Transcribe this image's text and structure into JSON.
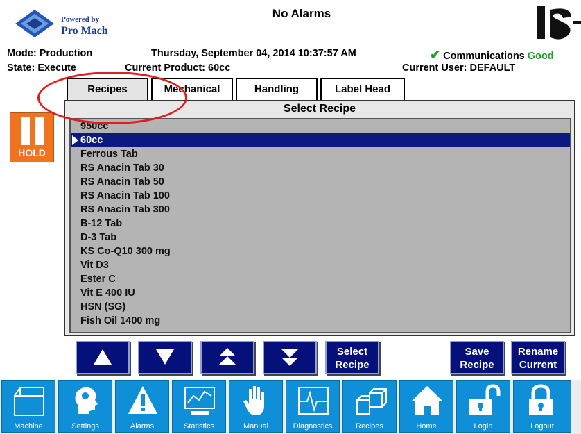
{
  "header": {
    "powered_by": "Powered by",
    "brand": "Pro Mach",
    "alarm_status": "No Alarms",
    "mode": "Mode: Production",
    "state": "State: Execute",
    "datetime": "Thursday, September 04, 2014 10:37:57 AM",
    "current_product": "Current Product: 60cc",
    "communications_label": "Communications",
    "communications_status": "Good",
    "current_user": "Current User:   DEFAULT"
  },
  "tabs": [
    {
      "label": "Recipes",
      "active": true
    },
    {
      "label": "Mechanical",
      "active": false
    },
    {
      "label": "Handling",
      "active": false
    },
    {
      "label": "Label Head",
      "active": false
    }
  ],
  "panel": {
    "title": "Select Recipe",
    "selected_recipe": "60cc",
    "recipes": [
      "950cc",
      "60cc",
      "Ferrous Tab",
      "RS Anacin Tab 30",
      "RS Anacin Tab 50",
      "RS Anacin Tab 100",
      "RS Anacin Tab 300",
      "B-12 Tab",
      "D-3 Tab",
      "KS Co-Q10 300 mg",
      "Vit D3",
      "Ester C",
      "Vit E 400 IU",
      "HSN (SG)",
      "Fish Oil 1400 mg"
    ]
  },
  "hold_button": {
    "label": "HOLD"
  },
  "nav_buttons": {
    "up": "up-arrow-icon",
    "down": "down-arrow-icon",
    "page_up": "double-up-arrow-icon",
    "page_down": "double-down-arrow-icon",
    "select_recipe": [
      "Select",
      "Recipe"
    ],
    "save_recipe": [
      "Save",
      "Recipe"
    ],
    "rename_current": [
      "Rename",
      "Current"
    ]
  },
  "bottom_nav": [
    {
      "label": "Machine",
      "icon": "machine-icon"
    },
    {
      "label": "Settings",
      "icon": "settings-head-icon"
    },
    {
      "label": "Alarms",
      "icon": "alarm-warning-icon"
    },
    {
      "label": "Statistics",
      "icon": "statistics-monitor-icon"
    },
    {
      "label": "Manual",
      "icon": "hand-icon"
    },
    {
      "label": "Diagnostics",
      "icon": "diagnostics-waveform-icon"
    },
    {
      "label": "Recipes",
      "icon": "recipes-boxes-icon"
    },
    {
      "label": "Home",
      "icon": "home-icon"
    },
    {
      "label": "Login",
      "icon": "unlocked-padlock-icon"
    },
    {
      "label": "Logout",
      "icon": "locked-padlock-icon"
    }
  ],
  "colors": {
    "nav_button": "#05107a",
    "bottom_button": "#0e8fd8",
    "hold": "#f0731f",
    "selection": "#0c1a80",
    "status_good": "#1fa01f",
    "highlight_oval": "#e11e1e"
  }
}
